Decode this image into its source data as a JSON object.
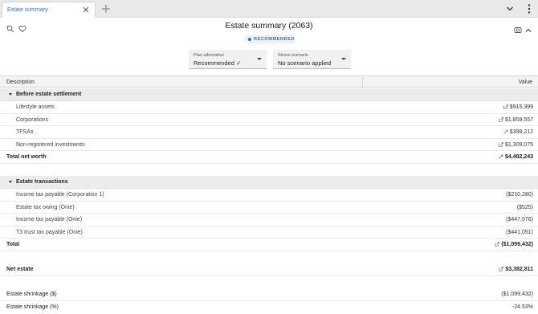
{
  "tab": {
    "label": "Estate summary"
  },
  "header": {
    "title": "Estate summary (2063)",
    "badge": "RECOMMENDED"
  },
  "filters": [
    {
      "label": "Plan alternative",
      "value": "Recommended ✓"
    },
    {
      "label": "Stress scenario",
      "value": "No scenario applied"
    }
  ],
  "table": {
    "col_description": "Description",
    "col_value": "Value",
    "sections": [
      {
        "title": "Before estate settlement",
        "items": [
          {
            "label": "Lifestyle assets",
            "value": "$915,399",
            "icon": "external-link-icon"
          },
          {
            "label": "Corporations",
            "value": "$1,859,557",
            "icon": "external-link-icon"
          },
          {
            "label": "TFSAs",
            "value": "$398,212",
            "icon": "trend-arrow-icon"
          },
          {
            "label": "Non-registered investments",
            "value": "$1,309,075",
            "icon": "external-link-icon"
          }
        ],
        "total": {
          "label": "Total net worth",
          "value": "$4,482,243",
          "icon": "trend-arrow-icon"
        }
      },
      {
        "title": "Estate transactions",
        "items": [
          {
            "label": "Income tax payable (Corporation 1)",
            "value": "($210,280)"
          },
          {
            "label": "Estate tax owing (Onie)",
            "value": "($525)"
          },
          {
            "label": "Income tax payable (Onie)",
            "value": "($447,576)"
          },
          {
            "label": "T3 trust tax payable (Onie)",
            "value": "($441,051)"
          }
        ],
        "total": {
          "label": "Total",
          "value": "($1,099,432)",
          "icon": "external-link-icon"
        }
      }
    ],
    "net_estate": {
      "label": "Net estate",
      "value": "$3,382,811",
      "icon": "external-link-icon"
    },
    "shrinkage_dollars": {
      "label": "Estate shrinkage ($)",
      "value": "($1,099,432)"
    },
    "shrinkage_percent": {
      "label": "Estate shrinkage (%)",
      "value": "-24.53%"
    }
  },
  "colors": {
    "accent": "#3a6fb5",
    "badge": "#4a6d8c",
    "section_bg": "#ececec"
  }
}
